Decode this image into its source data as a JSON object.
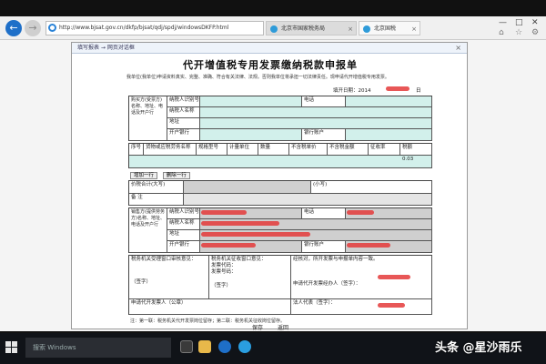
{
  "browser": {
    "address": "http://www.bjsat.gov.cn/dkfp/bjsat/qdj/spdj/windowsDKFP.html",
    "tabs": [
      {
        "label": "北京市国家税务局"
      },
      {
        "label": "北京国税"
      }
    ]
  },
  "document": {
    "header_label": "填写报表 → 网页对话框",
    "title": "代开增值税专用发票缴纳税款申报单",
    "instructions": "我单位(我单位)申请资料真实、完整、准确、符合有关法律、法规。否则我单位将承担一切法律责任。现申请代开增值税专用发票。",
    "fill_date_label": "填开日期：",
    "fill_date_year": "2014",
    "fill_date_day": "日"
  },
  "buyer": {
    "section_label": "购买方(受票方)名称、地址、电话及开户行",
    "tax_id_label": "纳税人识别号",
    "name_label": "纳税人名称",
    "address_label": "地址",
    "bank_label": "开户银行",
    "phone_label": "电话",
    "account_label": "银行账户"
  },
  "goods": {
    "columns": [
      "序号",
      "货物或应税劳务名称",
      "规格型号",
      "计量单位",
      "数量",
      "不含税单价",
      "不含税金额",
      "征收率",
      "税额"
    ],
    "row_tax_rate": "0.03",
    "add_row_label": "增加一行",
    "delete_row_label": "删除一行",
    "total_label": "价税合计(大写)",
    "subtotal_label": "(小写)",
    "remark_label": "备 注"
  },
  "seller": {
    "section_label": "销售方(提供劳务方)名称、地址、电话及开户行",
    "tax_id_label": "纳税人识别号",
    "name_label": "纳税人名称",
    "address_label": "地址",
    "bank_label": "开户银行",
    "phone_label": "电话",
    "account_label": "银行账户"
  },
  "signoff": {
    "col1": "税务机关受理窗口审核意见：",
    "col2": "税务机关征收窗口意见：",
    "col3": "经核对，所开发票与申报单内容一致。",
    "invoice_code": "发票代码：",
    "invoice_no": "发票号码：",
    "stamp1": "（签字）",
    "stamp2": "（签字）",
    "applicant": "申请代开发票经办人（签字）：",
    "handler": "申请代开发票人（公章）",
    "agent": "法人代表（签字）：",
    "year": "年",
    "month": "月",
    "day": "日"
  },
  "footer": {
    "note": "注：第一联：税务机关代开发票岗位留存；第二联：税务机关征收岗位留存。",
    "save_label": "保存",
    "return_label": "返回"
  },
  "taskbar": {
    "search_placeholder": "搜索 Windows"
  },
  "watermark": "头条 @星沙雨乐"
}
